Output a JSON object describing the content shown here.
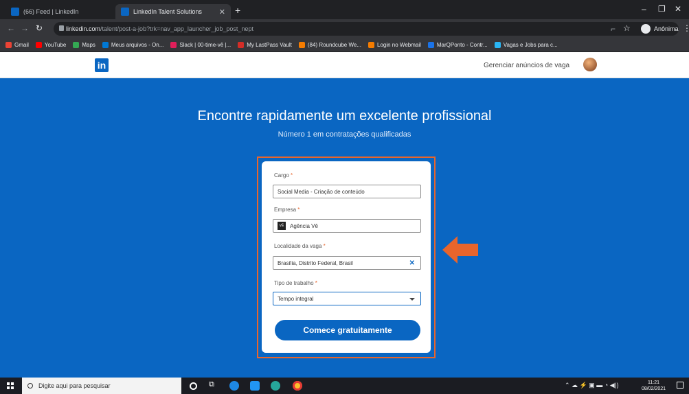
{
  "browser": {
    "tabs": [
      {
        "label": "(66) Feed | LinkedIn",
        "favicon_color": "#0a66c2",
        "active": false
      },
      {
        "label": "LinkedIn Talent Solutions",
        "favicon_color": "#0a66c2",
        "active": true
      }
    ],
    "new_tab_icon": "plus-icon",
    "address": {
      "domain": "linkedin.com",
      "path": "/talent/post-a-job?trk=nav_app_launcher_job_post_nept"
    },
    "profile_label": "Anônima",
    "bookmarks": [
      {
        "label": "Gmail",
        "color": "#ea4335"
      },
      {
        "label": "YouTube",
        "color": "#ff0000"
      },
      {
        "label": "Maps",
        "color": "#34a853"
      },
      {
        "label": "Meus arquivos - On...",
        "color": "#0078d4"
      },
      {
        "label": "Slack | 00-time-vê |...",
        "color": "#e01e5a"
      },
      {
        "label": "My LastPass Vault",
        "color": "#d32d27"
      },
      {
        "label": "(84) Roundcube We...",
        "color": "#f57c00"
      },
      {
        "label": "Login no Webmail",
        "color": "#f57c00"
      },
      {
        "label": "MarQPonto - Contr...",
        "color": "#1a73e8"
      },
      {
        "label": "Vagas e Jobs para c...",
        "color": "#29b6f6"
      }
    ]
  },
  "linkedin": {
    "logo_text": "in",
    "manage_jobs": "Gerenciar anúncios de vaga"
  },
  "hero": {
    "title": "Encontre rapidamente um excelente profissional",
    "subtitle": "Número 1 em contratações qualificadas"
  },
  "form": {
    "cargo_label": "Cargo",
    "cargo_value": "Social Media - Criação de conteúdo",
    "empresa_label": "Empresa",
    "empresa_value": "Agência Vê",
    "empresa_logo_text": "VÊ",
    "localidade_label": "Localidade da vaga",
    "localidade_value": "Brasília, Distrito Federal, Brasil",
    "tipo_label": "Tipo de trabalho",
    "tipo_value": "Tempo integral",
    "required_mark": "*",
    "clear_glyph": "✕",
    "submit_label": "Comece gratuitamente"
  },
  "taskbar": {
    "search_placeholder": "Digite aqui para pesquisar",
    "time": "11:21",
    "date": "08/02/2021"
  },
  "colors": {
    "brand": "#0a66c2",
    "highlight": "#e8652c"
  }
}
